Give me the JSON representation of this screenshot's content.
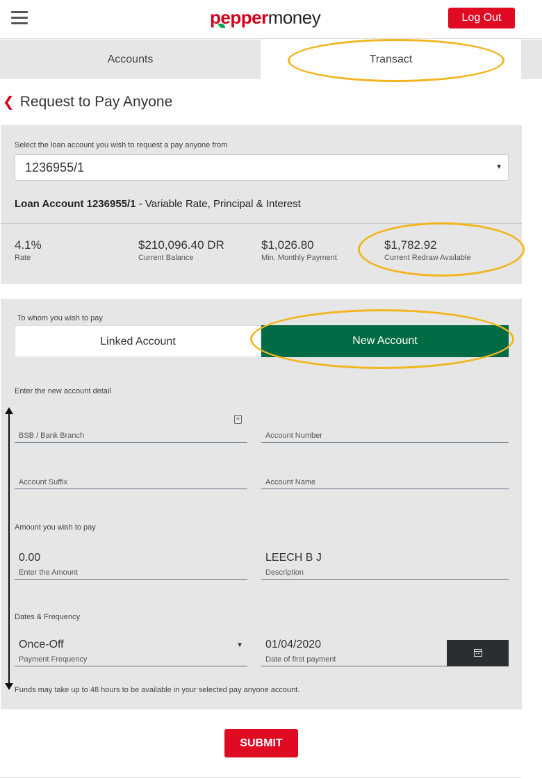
{
  "header": {
    "logo_first": "pepper",
    "logo_second": "money",
    "logout_label": "Log Out",
    "menu_icon": "hamburger-menu-icon"
  },
  "tabs": [
    {
      "label": "Accounts",
      "active": false
    },
    {
      "label": "Transact",
      "active": true
    }
  ],
  "page": {
    "title": "Request to Pay Anyone",
    "back_icon": "chevron-left-icon"
  },
  "loan": {
    "select_label": "Select the loan account you wish to request a pay anyone from",
    "selected_account": "1236955/1",
    "title_bold": "Loan Account 1236955/1",
    "title_rest": "- Variable Rate, Principal & Interest",
    "stats": [
      {
        "value": "4.1%",
        "label": "Rate"
      },
      {
        "value": "$210,096.40 DR",
        "label": "Current Balance"
      },
      {
        "value": "$1,026.80",
        "label": "Min. Monthly Payment"
      },
      {
        "value": "$1,782.92",
        "label": "Current Redraw Available"
      }
    ]
  },
  "payee": {
    "whom_label": "To whom you wish to pay",
    "linked_label": "Linked Account",
    "new_label": "New Account",
    "active_toggle": "New Account",
    "new_detail_label": "Enter the new account detail",
    "fields": {
      "bsb": {
        "value": "",
        "label": "BSB / Bank Branch",
        "icon": "lookup-book-icon"
      },
      "account_number": {
        "value": "",
        "label": "Account Number"
      },
      "account_suffix": {
        "value": "",
        "label": "Account Suffix"
      },
      "account_name": {
        "value": "",
        "label": "Account Name"
      }
    },
    "amount_section": "Amount you wish to pay",
    "amount": {
      "value": "0.00",
      "label": "Enter the Amount"
    },
    "description": {
      "value": "LEECH B J",
      "label": "Description"
    },
    "dates_section": "Dates & Frequency",
    "frequency": {
      "value": "Once-Off",
      "label": "Payment Frequency"
    },
    "first_payment": {
      "value": "01/04/2020",
      "label": "Date of first payment",
      "icon": "calendar-icon"
    },
    "note": "Funds may take up to 48 hours to be available in your selected pay anyone account."
  },
  "submit_label": "SUBMIT",
  "colors": {
    "brand_red": "#e10a23",
    "active_green": "#006b44",
    "panel_grey": "#e6e6e6",
    "annotation_yellow": "#f2b51d",
    "calendar_button": "#2a2e33"
  }
}
